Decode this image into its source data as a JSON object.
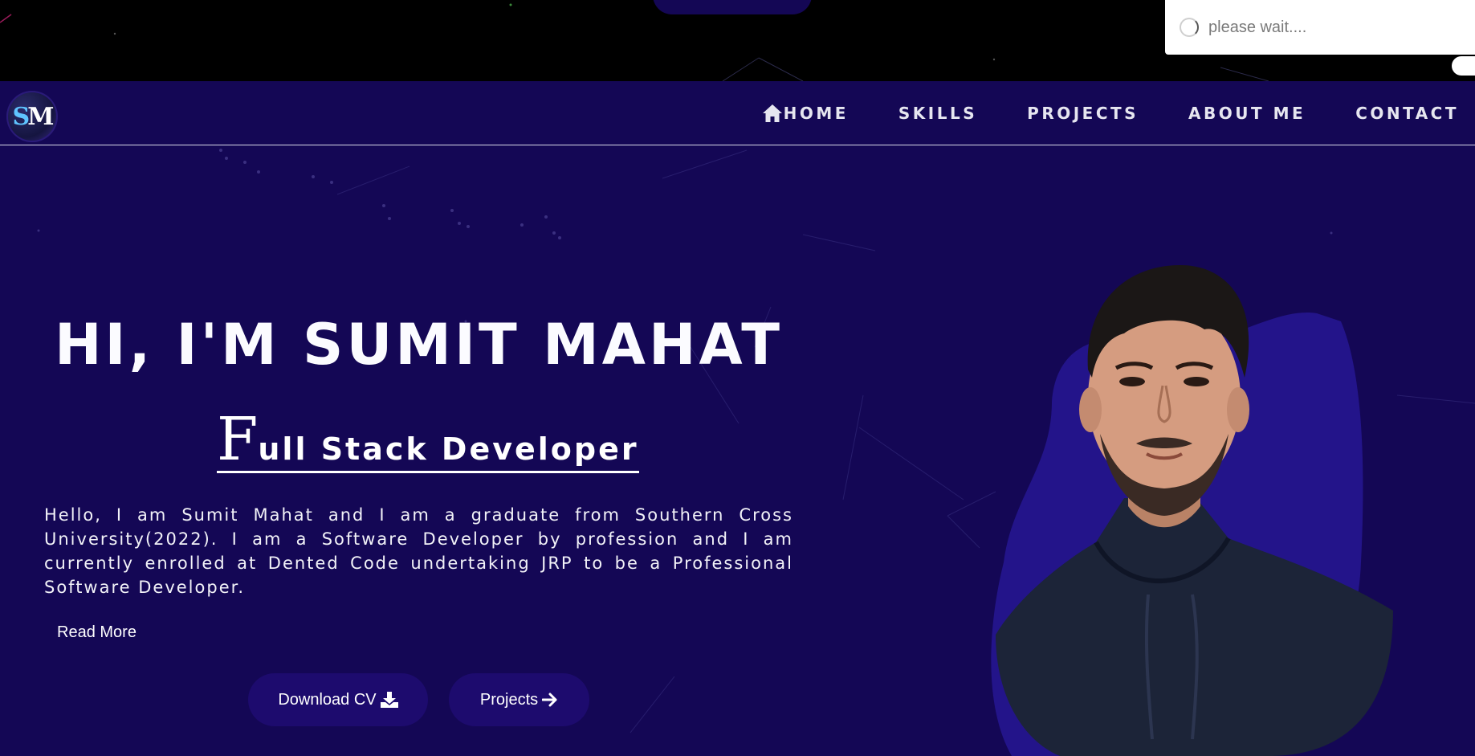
{
  "toast": {
    "text": "please wait...."
  },
  "logo": {
    "letters_1": "S",
    "letters_2": "M"
  },
  "nav": {
    "items": [
      {
        "label": "HOME",
        "icon": "home-icon"
      },
      {
        "label": "SKILLS"
      },
      {
        "label": "PROJECTS"
      },
      {
        "label": "ABOUT ME"
      },
      {
        "label": "CONTACT"
      }
    ]
  },
  "hero": {
    "title": "HI, I'M SUMIT MAHAT",
    "subtitle_first": "F",
    "subtitle_rest": "ull Stack Developer",
    "intro": "Hello, I am Sumit Mahat and I am a graduate from Southern Cross University(2022). I am a Software Developer by profession and I am currently enrolled at Dented Code undertaking JRP to be a Professional Software Developer.",
    "read_more": "Read More",
    "download_cv": "Download CV",
    "projects": "Projects"
  },
  "colors": {
    "background": "#140755",
    "button": "#1d0b6e",
    "blob": "#23148a"
  }
}
